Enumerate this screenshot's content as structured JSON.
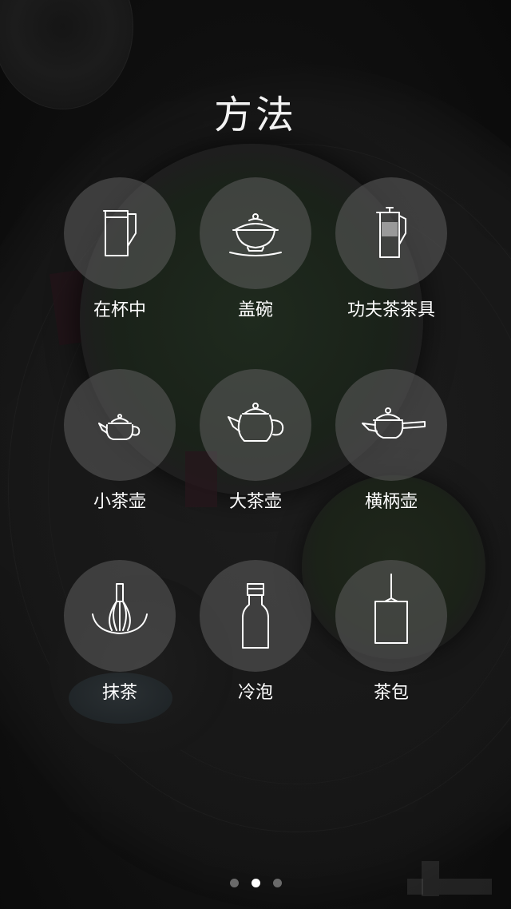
{
  "title": "方法",
  "methods": [
    {
      "label": "在杯中",
      "icon": "glass-cup-icon"
    },
    {
      "label": "盖碗",
      "icon": "gaiwan-icon"
    },
    {
      "label": "功夫茶茶具",
      "icon": "gongfu-pitcher-icon"
    },
    {
      "label": "小茶壶",
      "icon": "small-teapot-icon"
    },
    {
      "label": "大茶壶",
      "icon": "large-teapot-icon"
    },
    {
      "label": "横柄壶",
      "icon": "side-handle-teapot-icon"
    },
    {
      "label": "抹茶",
      "icon": "matcha-whisk-icon"
    },
    {
      "label": "冷泡",
      "icon": "cold-brew-bottle-icon"
    },
    {
      "label": "茶包",
      "icon": "tea-bag-icon"
    }
  ],
  "pager": {
    "total": 3,
    "active_index": 1
  },
  "colors": {
    "circle_fill": "#5f5f5f",
    "icon_stroke": "#ffffff",
    "label_text": "#ffffff",
    "dot_active": "#ffffff",
    "dot_inactive": "#6a6a6a"
  }
}
